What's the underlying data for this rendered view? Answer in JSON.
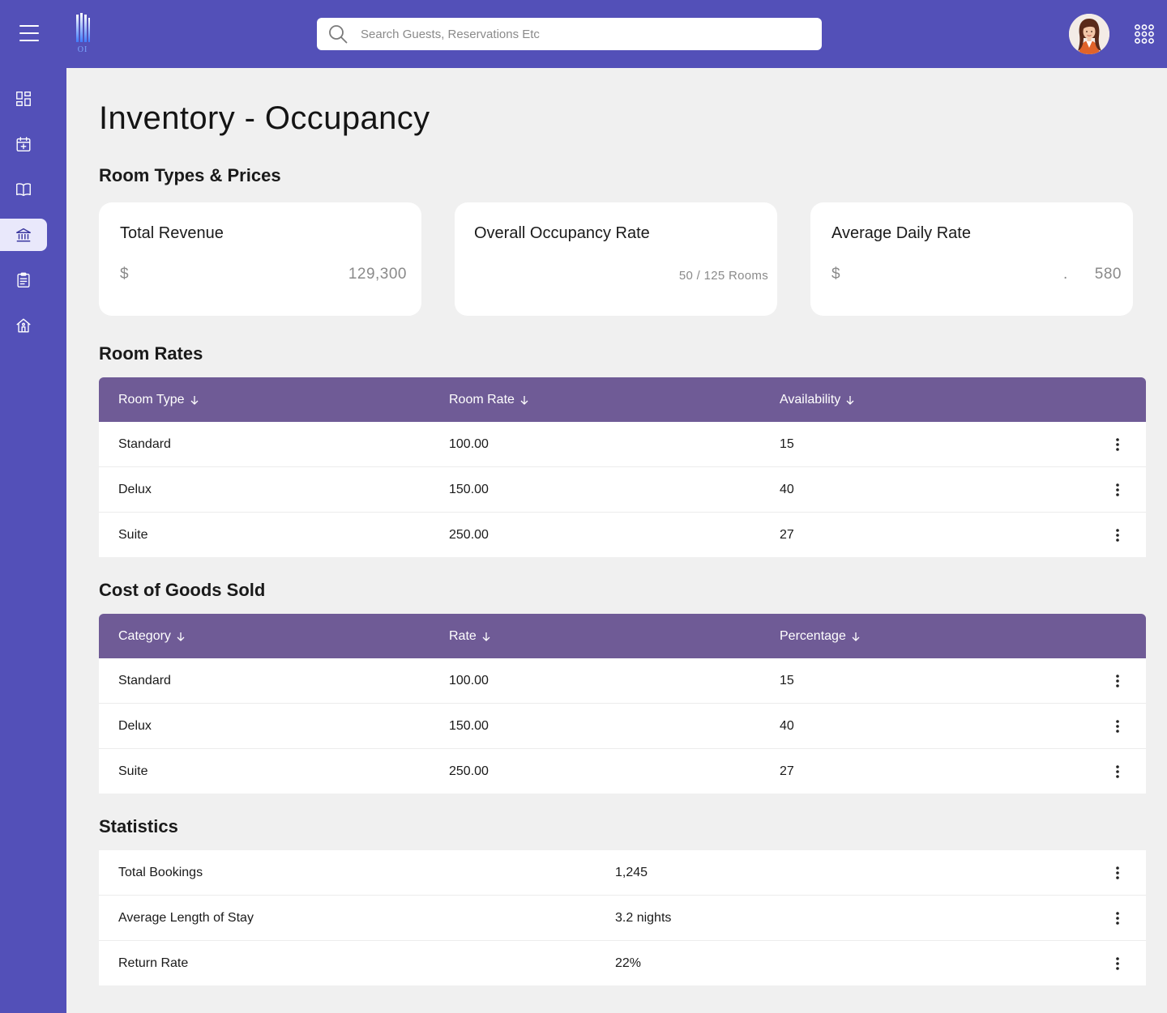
{
  "header": {
    "logo_text": "OI",
    "search_placeholder": "Search Guests, Reservations Etc",
    "icons": [
      "hamburger-icon",
      "building-logo",
      "search-icon",
      "avatar",
      "apps-grid-icon"
    ]
  },
  "sidebar": {
    "items": [
      {
        "icon": "dashboard-icon",
        "active": false
      },
      {
        "icon": "calendar-add-icon",
        "active": false
      },
      {
        "icon": "book-icon",
        "active": false
      },
      {
        "icon": "bank-icon",
        "active": true
      },
      {
        "icon": "clipboard-icon",
        "active": false
      },
      {
        "icon": "home-icon",
        "active": false
      }
    ]
  },
  "page": {
    "title": "Inventory - Occupancy",
    "room_types_title": "Room Types & Prices",
    "room_rates_title": "Room Rates",
    "cogs_title": "Cost of Goods Sold",
    "statistics_title": "Statistics"
  },
  "cards": {
    "total_revenue": {
      "label": "Total Revenue",
      "currency": "$",
      "value": "129,300"
    },
    "occupancy": {
      "label": "Overall Occupancy Rate",
      "sub": "50 / 125 Rooms"
    },
    "adr": {
      "label": "Average Daily Rate",
      "currency": "$",
      "dot": ".",
      "value": "580"
    }
  },
  "room_rates": {
    "columns": [
      "Room Type",
      "Room Rate",
      "Availability"
    ],
    "rows": [
      [
        "Standard",
        "100.00",
        "15"
      ],
      [
        "Delux",
        "150.00",
        "40"
      ],
      [
        "Suite",
        "250.00",
        "27"
      ]
    ]
  },
  "cogs": {
    "columns": [
      "Category",
      "Rate",
      "Percentage"
    ],
    "rows": [
      [
        "Standard",
        "100.00",
        "15"
      ],
      [
        "Delux",
        "150.00",
        "40"
      ],
      [
        "Suite",
        "250.00",
        "27"
      ]
    ]
  },
  "statistics": {
    "rows": [
      [
        "Total Bookings",
        "1,245"
      ],
      [
        "Average Length of Stay",
        "3.2 nights"
      ],
      [
        "Return Rate",
        "22%"
      ]
    ]
  },
  "colors": {
    "brand": "#5350b8",
    "table_header": "#6f5b96",
    "background": "#f0f0f0",
    "sidebar_active": "#e9e8fb"
  }
}
